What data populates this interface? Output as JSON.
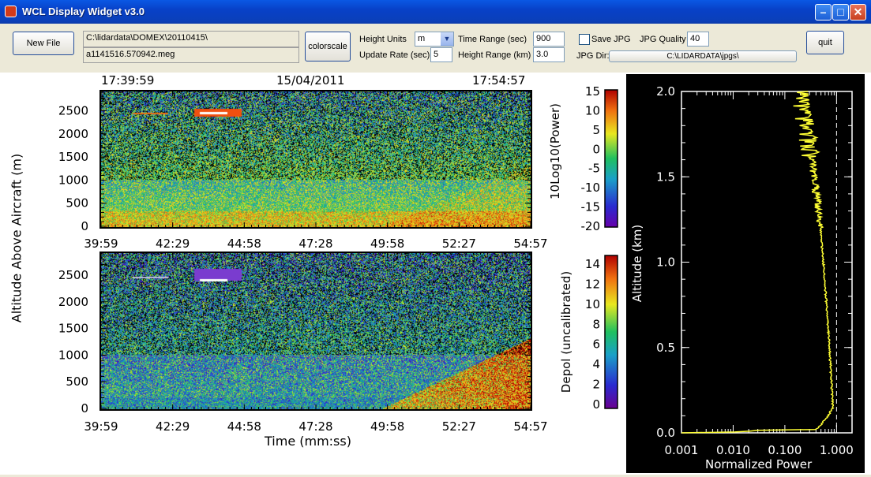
{
  "window": {
    "title": "WCL Display Widget  v3.0",
    "min": "–",
    "max": "□",
    "close": "✕"
  },
  "controls": {
    "new_file": "New File",
    "path_dir": "C:\\lidardata\\DOMEX\\20110415\\",
    "path_file": "a1141516.570942.meg",
    "colorscale": "colorscale",
    "height_units_label": "Height Units",
    "height_units_value": "m",
    "update_rate_label": "Update Rate (sec)",
    "update_rate_value": "5",
    "time_range_label": "Time Range (sec)",
    "time_range_value": "900",
    "height_range_label": "Height Range (km)",
    "height_range_value": "3.0",
    "save_jpg_label": "Save JPG",
    "jpg_quality_label": "JPG Quality",
    "jpg_quality_value": "40",
    "jpg_dir_label": "JPG Dir:",
    "jpg_dir_value": "C:\\LIDARDATA\\jpgs\\",
    "quit": "quit"
  },
  "plots": {
    "start_time": "17:39:59",
    "date": "15/04/2011",
    "end_time": "17:54:57",
    "y_label": "Altitude Above Aircraft  (m)",
    "x_label": "Time  (mm:ss)",
    "x_ticks": [
      "39:59",
      "42:29",
      "44:58",
      "47:28",
      "49:58",
      "52:27",
      "54:57"
    ],
    "y_ticks": [
      "0",
      "500",
      "1000",
      "1500",
      "2000",
      "2500"
    ],
    "power_cbar_label": "10Log10(Power)",
    "power_cbar_ticks": [
      "15",
      "10",
      "5",
      "0",
      "-5",
      "-10",
      "-15",
      "-20"
    ],
    "depol_cbar_label": "Depol  (uncalibrated)",
    "depol_cbar_ticks": [
      "14",
      "12",
      "10",
      "8",
      "6",
      "4",
      "2",
      "0"
    ],
    "profile_y_label": "Altitude  (km)",
    "profile_x_label": "Normalized  Power",
    "profile_y_ticks": [
      "0.0",
      "0.5",
      "1.0",
      "1.5",
      "2.0"
    ],
    "profile_x_ticks": [
      "0.001",
      "0.010",
      "0.100",
      "1.000"
    ]
  },
  "colors": {
    "window_bg": "#ece9d8",
    "title_bar": "#0a4fd8",
    "profile_line": "#ffff33"
  }
}
